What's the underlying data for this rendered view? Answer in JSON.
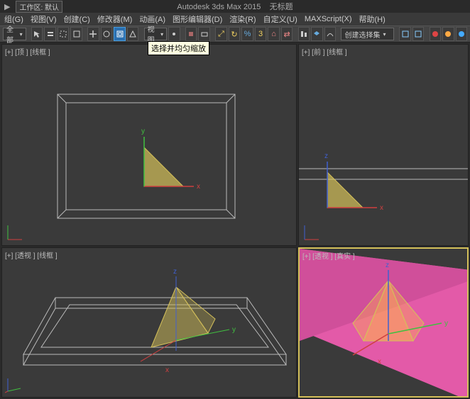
{
  "titlebar": {
    "triangle": "▶",
    "workspace_label": "工作区: 默认",
    "app_title": "Autodesk 3ds Max 2015",
    "doc_title": "无标题"
  },
  "menu": {
    "group": "组(G)",
    "view": "视图(V)",
    "create": "创建(C)",
    "modifier": "修改器(M)",
    "animation": "动画(A)",
    "grapheditor": "图形编辑器(D)",
    "render": "渲染(R)",
    "custom": "自定义(U)",
    "maxscript": "MAXScript(X)",
    "help": "帮助(H)"
  },
  "toolbar": {
    "all_dropdown": "全部",
    "view_dropdown": "视图",
    "selset_dropdown": "创建选择集"
  },
  "tooltip": {
    "scale": "选择并均匀缩放"
  },
  "viewports": {
    "top": "[+] [顶 ] [线框 ]",
    "front": "[+] [前 ] [线框 ]",
    "persp_wire": "[+] [透视 ] [线框 ]",
    "persp_real": "[+] [透视 ] [真实 ]"
  },
  "axes": {
    "x": "x",
    "y": "y",
    "z": "z"
  },
  "colors": {
    "accent_yellow": "#d4c05a",
    "pink_plane": "#e35aa8",
    "axis_red": "#d04040",
    "axis_green": "#40c040",
    "axis_blue": "#4060d0"
  },
  "chart_data": null
}
